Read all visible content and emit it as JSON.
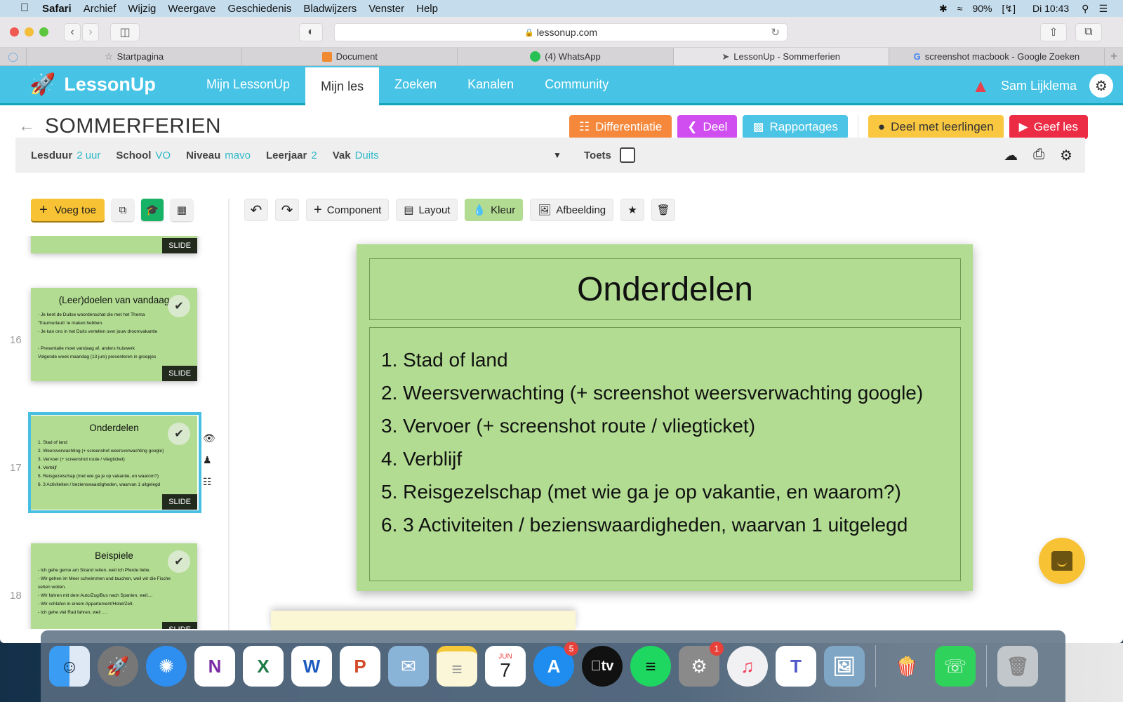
{
  "menubar": {
    "app": "Safari",
    "items": [
      "Archief",
      "Wijzig",
      "Weergave",
      "Geschiedenis",
      "Bladwijzers",
      "Venster",
      "Help"
    ],
    "battery": "90%",
    "clock": "Di 10:43"
  },
  "browser": {
    "url": "lessonup.com",
    "tabs": [
      {
        "label": "Startpagina",
        "icon": "star-icon"
      },
      {
        "label": "Document",
        "icon": "document-icon"
      },
      {
        "label": "(4) WhatsApp",
        "icon": "whatsapp-icon"
      },
      {
        "label": "LessonUp - Sommerferien",
        "icon": "rocket-icon",
        "active": true
      },
      {
        "label": "screenshot macbook - Google Zoeken",
        "icon": "google-icon"
      }
    ]
  },
  "header": {
    "logo": "LessonUp",
    "nav": [
      "Mijn LessonUp",
      "Mijn les",
      "Zoeken",
      "Kanalen",
      "Community"
    ],
    "active_nav": "Mijn les",
    "user": "Sam Lijklema"
  },
  "page": {
    "title": "SOMMERFERIEN",
    "actions": {
      "differentiatie": "Differentiatie",
      "deel": "Deel",
      "rapportages": "Rapportages",
      "deel_leerlingen": "Deel met leerlingen",
      "geef_les": "Geef les"
    },
    "colors": {
      "differentiatie": "#f5883b",
      "deel": "#d04ef0",
      "rapportages": "#4bc4e5",
      "deel_leerlingen": "#f9c740",
      "geef_les": "#ec2b45",
      "brand": "#46c3e5",
      "slide_bg": "#b1dc91"
    }
  },
  "meta": {
    "lesduur": {
      "label": "Lesduur",
      "value": "2 uur"
    },
    "school": {
      "label": "School",
      "value": "VO"
    },
    "niveau": {
      "label": "Niveau",
      "value": "mavo"
    },
    "leerjaar": {
      "label": "Leerjaar",
      "value": "2"
    },
    "vak": {
      "label": "Vak",
      "value": "Duits"
    },
    "toets": {
      "label": "Toets",
      "checked": false
    }
  },
  "left_toolbar": {
    "add": "Voeg toe"
  },
  "editor_toolbar": {
    "component": "Component",
    "layout": "Layout",
    "kleur": "Kleur",
    "afbeelding": "Afbeelding"
  },
  "slides": [
    {
      "number": "",
      "title": "",
      "body": "",
      "badge": "SLIDE"
    },
    {
      "number": "16",
      "title": "(Leer)doelen van vandaag",
      "body": "- Je kent de Duitse woordenschat die met het Thema\n'Traumurlaub' te maken hebben.\n- Je kan ons in het Duits vertellen over jouw droomvakantie\n\n- Presentatie moet vandaag af, anders huiswerk\nVolgende week maandag (13 juni) presenteren in groepjes",
      "badge": "SLIDE"
    },
    {
      "number": "17",
      "title": "Onderdelen",
      "body": "1. Stad of land\n2. Weersverwachting (+ screenshot weersverwachting google)\n3. Vervoer (+ screenshot route / vliegticket)\n4. Verblijf\n5. Reisgezelschap (met wie ga je op vakantie, en waarom?)\n6. 3 Activiteiten / bezienswaardigheden, waarvan 1 uitgelegd",
      "badge": "SLIDE",
      "selected": true
    },
    {
      "number": "18",
      "title": "Beispiele",
      "body": " - Ich gehe gerne am Strand reiten, weil ich Pferde liebe.\n- Wir gehen im Meer schwimmen und tauchen, weil wir die Fische\nsehen wollen.\n- Wir fahren mit dem Auto/Zug/Bus nach Spanien, weil....\n- Wir schlafen in einem Appartement/Hotel/Zelt.\n- Ich gehe viel Rad fahren, weil ....",
      "badge": "SLIDE"
    }
  ],
  "main_slide": {
    "title": "Onderdelen",
    "lines": [
      "1. Stad of land",
      "2. Weersverwachting (+ screenshot weersverwachting google)",
      "3. Vervoer (+ screenshot route / vliegticket)",
      "4. Verblijf",
      "5. Reisgezelschap (met wie ga je op vakantie, en waarom?)",
      "6. 3 Activiteiten / bezienswaardigheden, waarvan 1 uitgelegd"
    ]
  },
  "dock": {
    "calendar_month": "JUN",
    "calendar_day": "7",
    "appstore_badge": "5",
    "settings_badge": "1",
    "tv_label": "tv"
  }
}
